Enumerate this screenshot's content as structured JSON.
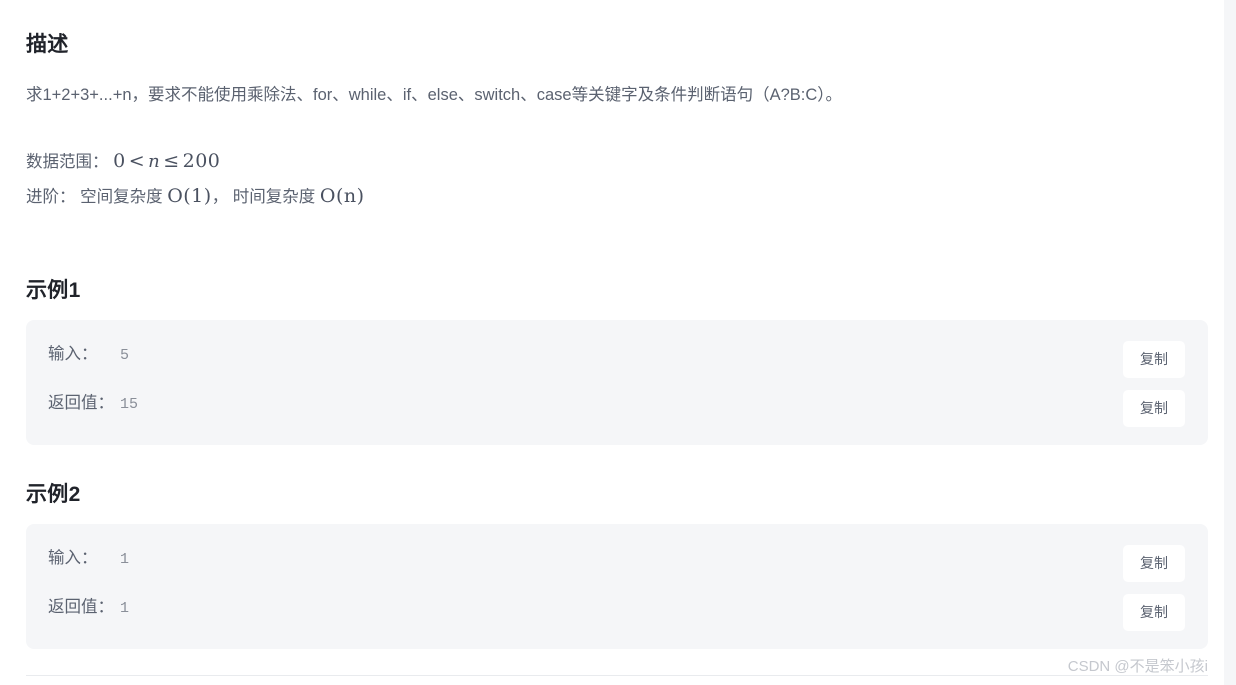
{
  "description": {
    "title": "描述",
    "paragraph": "求1+2+3+...+n，要求不能使用乘除法、for、while、if、else、switch、case等关键字及条件判断语句（A?B:C）。",
    "range_label": "数据范围：",
    "range_math": "0 < n ≤ 200",
    "range_math_parts": {
      "lhs": "0",
      "op1": "<",
      "var": "n",
      "op2": "≤",
      "rhs": "200"
    },
    "advanced_label": "进阶：",
    "advanced_space_label": "空间复杂度",
    "advanced_space_math": "O(1)",
    "advanced_separator": "，",
    "advanced_time_label": "时间复杂度",
    "advanced_time_math": "O(n)"
  },
  "examples": [
    {
      "title": "示例1",
      "input_label": "输入：",
      "input_value": "5",
      "return_label": "返回值：",
      "return_value": "15",
      "copy_label": "复制"
    },
    {
      "title": "示例2",
      "input_label": "输入：",
      "input_value": "1",
      "return_label": "返回值：",
      "return_value": "1",
      "copy_label": "复制"
    }
  ],
  "watermark": "CSDN @不是笨小孩i",
  "colors": {
    "page_background": "#ffffff",
    "panel_background": "#f5f6f8",
    "heading_text": "#20232a",
    "body_text": "#5b6270",
    "value_text": "#8a8f99",
    "watermark_text": "#c5c8ce",
    "divider": "#e9ebee"
  }
}
